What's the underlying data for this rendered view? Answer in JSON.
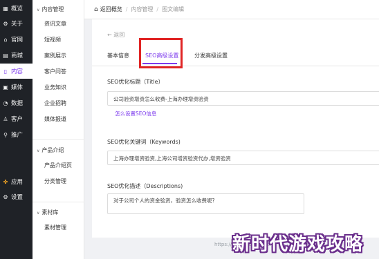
{
  "sidebar": {
    "items": [
      {
        "icon": "grid-icon",
        "glyph": "▦",
        "label": "概览"
      },
      {
        "icon": "gear-icon",
        "glyph": "⚙",
        "label": "关于"
      },
      {
        "icon": "home-icon",
        "glyph": "⌂",
        "label": "官网"
      },
      {
        "icon": "store-icon",
        "glyph": "▤",
        "label": "商城"
      },
      {
        "icon": "document-icon",
        "glyph": "▯",
        "label": "内容"
      },
      {
        "icon": "media-icon",
        "glyph": "▣",
        "label": "媒体"
      },
      {
        "icon": "chart-icon",
        "glyph": "◔",
        "label": "数据"
      },
      {
        "icon": "user-icon",
        "glyph": "♙",
        "label": "客户"
      },
      {
        "icon": "share-icon",
        "glyph": "⚲",
        "label": "推广"
      },
      {
        "icon": "apps-icon",
        "glyph": "✤",
        "label": "应用"
      },
      {
        "icon": "settings-icon",
        "glyph": "⚙",
        "label": "设置"
      }
    ],
    "active_index": 4
  },
  "subnav": {
    "groups": [
      {
        "label": "内容管理",
        "items": [
          "资讯文章",
          "短视频",
          "案例展示",
          "客户问答",
          "业务知识",
          "企业招聘",
          "媒体报道"
        ]
      },
      {
        "label": "产品介绍",
        "items": [
          "产品介绍页",
          "分类管理"
        ]
      },
      {
        "label": "素材库",
        "items": [
          "素材管理"
        ]
      }
    ]
  },
  "breadcrumb": {
    "home_label": "返回概览",
    "items": [
      "内容管理",
      "图文编辑"
    ]
  },
  "page": {
    "back_label": "← 返回",
    "tabs": [
      "基本信息",
      "SEO高级设置",
      "分发高级设置"
    ],
    "active_tab": 1,
    "seo_title_label": "SEO优化标题（Title）",
    "seo_title_value": "公司验资增资怎么收费-上海办理增资验资",
    "help_link": "怎么设置SEO信息",
    "keywords_label": "SEO优化关键词（Keywords)",
    "keywords_value": "上海办理增资验资,上海公司增资验资代办,增资验资",
    "description_label": "SEO优化描述（Descriptions)",
    "description_value": "对于公司个人的资金验资，验资怎么收费呢?"
  },
  "footer_url": "https://blog.csdn.net/...",
  "watermark": "新时代游戏攻略",
  "colors": {
    "accent": "#7c3aed",
    "highlight": "#e02424",
    "sidebar_bg": "#1f2227"
  }
}
